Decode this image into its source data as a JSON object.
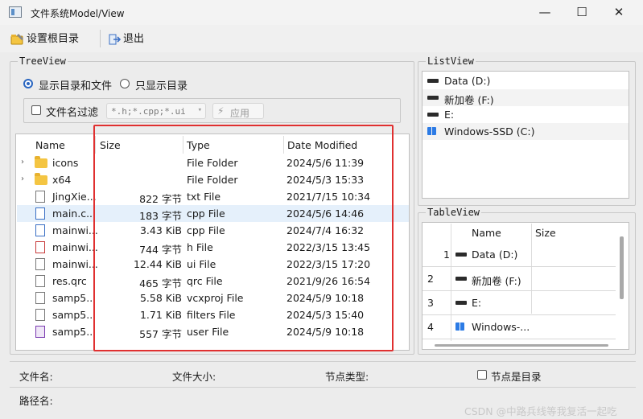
{
  "window": {
    "title": "文件系统Model/View",
    "minimize_glyph": "—",
    "maximize_glyph": "☐",
    "close_glyph": "✕"
  },
  "toolbar": {
    "set_root_label": "设置根目录",
    "exit_label": "退出"
  },
  "treeview_group": {
    "title": "TreeView",
    "radio_show_all": "显示目录和文件",
    "radio_dirs_only": "只显示目录",
    "filter_checkbox_label": "文件名过滤",
    "filter_value": "*.h;*.cpp;*.ui",
    "apply_button": "应用"
  },
  "tree": {
    "headers": [
      "Name",
      "Size",
      "Type",
      "Date Modified"
    ],
    "rows": [
      {
        "name": "icons",
        "size": "",
        "type": "File Folder",
        "date": "2024/5/6 11:39",
        "icon": "folder-icon",
        "expandable": true
      },
      {
        "name": "x64",
        "size": "",
        "type": "File Folder",
        "date": "2024/5/3 15:33",
        "icon": "folder-icon",
        "expandable": true
      },
      {
        "name": "JingXie...",
        "size": "822 字节",
        "type": "txt File",
        "date": "2021/7/15 10:34",
        "icon": "text-file-icon",
        "expandable": false
      },
      {
        "name": "main.c...",
        "size": "183 字节",
        "type": "cpp File",
        "date": "2024/5/6 14:46",
        "icon": "cpp-file-icon",
        "expandable": false,
        "selected": true
      },
      {
        "name": "mainwi...",
        "size": "3.43 KiB",
        "type": "cpp File",
        "date": "2024/7/4 16:32",
        "icon": "cpp-file-icon",
        "expandable": false
      },
      {
        "name": "mainwi...",
        "size": "744 字节",
        "type": "h File",
        "date": "2022/3/15 13:45",
        "icon": "header-file-icon",
        "expandable": false
      },
      {
        "name": "mainwi...",
        "size": "12.44 KiB",
        "type": "ui File",
        "date": "2022/3/15 17:20",
        "icon": "ui-file-icon",
        "expandable": false
      },
      {
        "name": "res.qrc",
        "size": "465 字节",
        "type": "qrc File",
        "date": "2021/9/26 16:54",
        "icon": "text-file-icon",
        "expandable": false
      },
      {
        "name": "samp5...",
        "size": "5.58 KiB",
        "type": "vcxproj File",
        "date": "2024/5/9 10:18",
        "icon": "text-file-icon",
        "expandable": false
      },
      {
        "name": "samp5...",
        "size": "1.71 KiB",
        "type": "filters File",
        "date": "2024/5/3 15:40",
        "icon": "text-file-icon",
        "expandable": false
      },
      {
        "name": "samp5...",
        "size": "557 字节",
        "type": "user File",
        "date": "2024/5/9 10:18",
        "icon": "vs-file-icon",
        "expandable": false
      }
    ]
  },
  "listview_group": {
    "title": "ListView",
    "items": [
      {
        "label": "Data (D:)",
        "icon": "drive-icon"
      },
      {
        "label": "新加卷 (F:)",
        "icon": "drive-icon"
      },
      {
        "label": "E:",
        "icon": "drive-icon"
      },
      {
        "label": "Windows-SSD (C:)",
        "icon": "windows-drive-icon"
      }
    ]
  },
  "tableview_group": {
    "title": "TableView",
    "headers": [
      "Name",
      "Size"
    ],
    "rows": [
      {
        "num": "1",
        "name": "Data (D:)",
        "icon": "drive-icon"
      },
      {
        "num": "2",
        "name": "新加卷 (F:)",
        "icon": "drive-icon"
      },
      {
        "num": "3",
        "name": "E:",
        "icon": "drive-icon"
      },
      {
        "num": "4",
        "name": "Windows-...",
        "icon": "windows-drive-icon"
      }
    ]
  },
  "status": {
    "file_name_label": "文件名:",
    "file_size_label": "文件大小:",
    "node_type_label": "节点类型:",
    "is_dir_label": "节点是目录",
    "path_label": "路径名:"
  },
  "watermark": "CSDN @中路兵线等我复活一起吃"
}
